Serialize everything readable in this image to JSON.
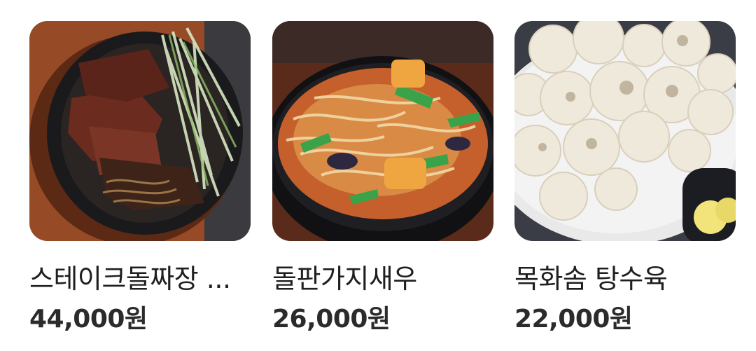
{
  "menu": {
    "items": [
      {
        "name": "스테이크돌짜장 ...",
        "price": "44,000원",
        "photo_icon": "steak-jjajang-photo"
      },
      {
        "name": "돌판가지새우",
        "price": "26,000원",
        "photo_icon": "eggplant-shrimp-photo"
      },
      {
        "name": "목화솜 탕수육",
        "price": "22,000원",
        "photo_icon": "sweet-sour-pork-photo"
      }
    ]
  }
}
